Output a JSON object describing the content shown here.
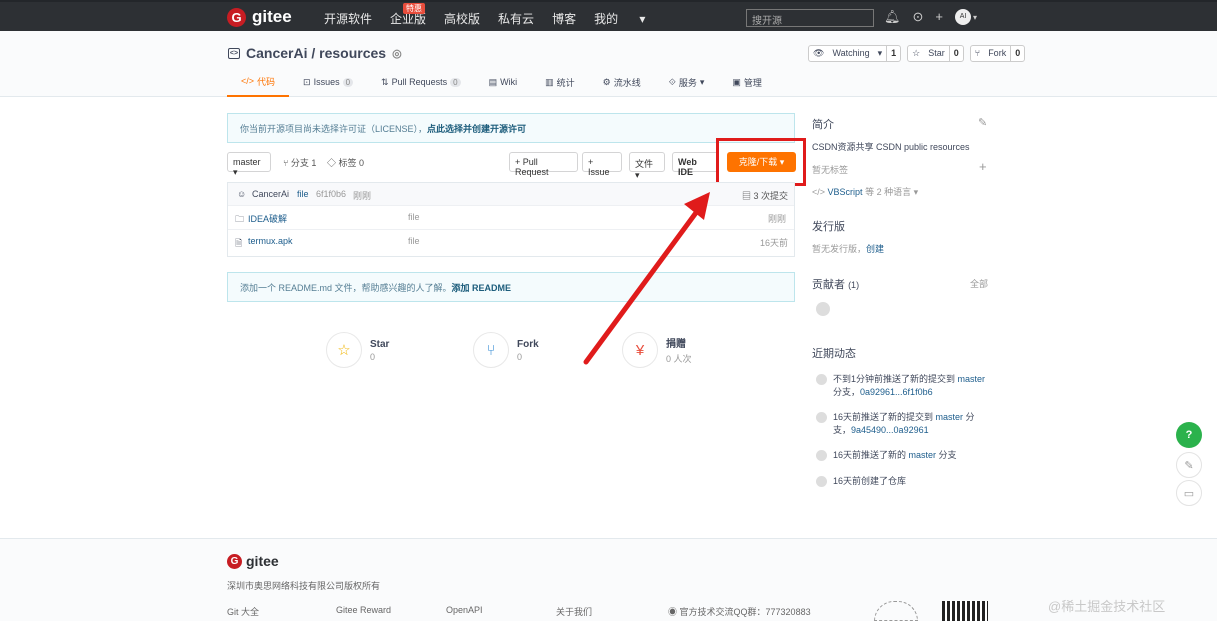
{
  "topbar": {
    "brand": "gitee",
    "logo_letter": "G",
    "nav": [
      "开源软件",
      "企业版",
      "高校版",
      "私有云",
      "博客",
      "我的"
    ],
    "badge": "特惠",
    "search_placeholder": "搜开源",
    "avatar": "AI"
  },
  "repo": {
    "title": "CancerAi / resources",
    "watching_label": "Watching",
    "watching_count": "1",
    "star_label": "Star",
    "star_count": "0",
    "fork_label": "Fork",
    "fork_count": "0"
  },
  "tabs": [
    {
      "label": "代码",
      "icon": "</>"
    },
    {
      "label": "Issues",
      "icon": "⊡",
      "count": "0"
    },
    {
      "label": "Pull Requests",
      "icon": "⇅",
      "count": "0"
    },
    {
      "label": "Wiki",
      "icon": "▤"
    },
    {
      "label": "统计",
      "icon": "▥"
    },
    {
      "label": "流水线",
      "icon": "⚙"
    },
    {
      "label": "服务",
      "icon": "⟐"
    },
    {
      "label": "管理",
      "icon": "▣"
    }
  ],
  "notice": {
    "text": "你当前开源项目尚未选择许可证（LICENSE），",
    "link": "点此选择并创建开源许可"
  },
  "branchbar": {
    "branch": "master",
    "branches": "分支 1",
    "tags": "标签 0",
    "pull_request": "+ Pull Request",
    "issue": "+ Issue",
    "file": "文件",
    "webide": "Web IDE",
    "clone": "克隆/下载"
  },
  "commit": {
    "author": "CancerAi",
    "message": "file",
    "hash": "6f1f0b6",
    "time": "刚刚",
    "count": "3 次提交"
  },
  "files": [
    {
      "name": "IDEA破解",
      "message": "file",
      "time": "刚刚"
    },
    {
      "name": "termux.apk",
      "message": "file",
      "time": "16天前"
    }
  ],
  "readme": {
    "text": "添加一个 README.md 文件，帮助感兴趣的人了解。",
    "link": "添加 README"
  },
  "stats": [
    {
      "label": "Star",
      "value": "0"
    },
    {
      "label": "Fork",
      "value": "0"
    },
    {
      "label": "捐赠",
      "value": "0 人次"
    }
  ],
  "sidebar": {
    "intro_title": "简介",
    "intro_text": "CSDN资源共享 CSDN public resources",
    "no_tags": "暂无标签",
    "language_prefix": "VBScript",
    "language_suffix": "等 2 种语言",
    "release_title": "发行版",
    "release_none": "暂无发行版，",
    "release_create": "创建",
    "contrib_title": "贡献者",
    "contrib_count": "(1)",
    "contrib_all": "全部",
    "activity_title": "近期动态",
    "activities": [
      {
        "pre": "不到1分钟前推送了新的提交到 ",
        "link": "master",
        "mid": " 分支，",
        "link2": "0a92961...6f1f0b6"
      },
      {
        "pre": "16天前推送了新的提交到 ",
        "link": "master",
        "mid": " 分支，",
        "link2": "9a45490...0a92961"
      },
      {
        "pre": "16天前推送了新的 ",
        "link": "master",
        "mid": " 分支",
        "link2": ""
      },
      {
        "pre": "16天前创建了仓库",
        "link": "",
        "mid": "",
        "link2": ""
      }
    ]
  },
  "footer": {
    "brand": "gitee",
    "copyright": "深圳市奥思网络科技有限公司版权所有",
    "links": [
      "Git 大全",
      "Gitee Reward",
      "OpenAPI",
      "关于我们"
    ],
    "qq": "官方技术交流QQ群：777320883",
    "watermark": "@稀土掘金技术社区"
  },
  "colors": {
    "accent": "#fe7300",
    "highlight": "#e01b1b",
    "topbar": "#2d3034"
  }
}
